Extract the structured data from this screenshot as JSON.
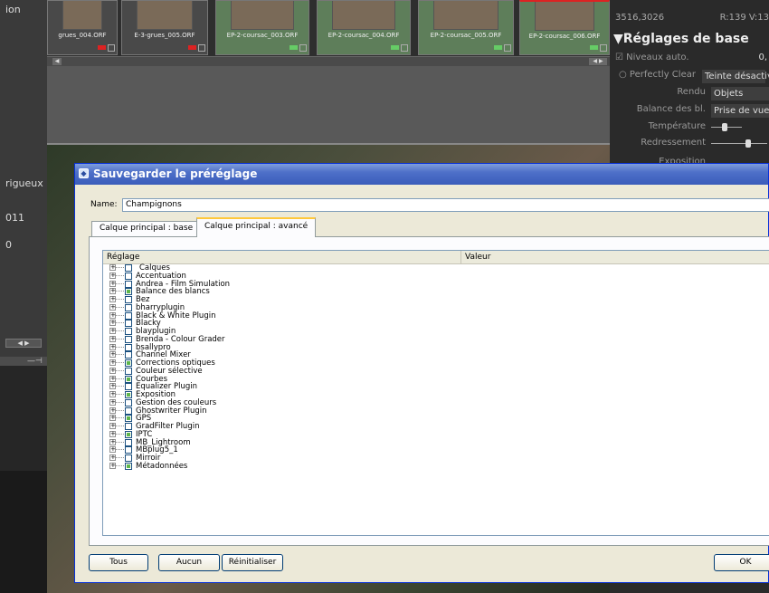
{
  "left_panel": {
    "labels": [
      "ion",
      "rigueux",
      "011",
      "0"
    ]
  },
  "filmstrip": {
    "thumbs": [
      {
        "name": "grues_004.ORF",
        "color": "gray",
        "flag": "#d22"
      },
      {
        "name": "E-3-grues_005.ORF",
        "color": "gray",
        "flag": "#d22"
      },
      {
        "name": "EP-2-coursac_003.ORF",
        "color": "green",
        "flag": "#6c6"
      },
      {
        "name": "EP-2-coursac_004.ORF",
        "color": "green",
        "flag": "#6c6"
      },
      {
        "name": "EP-2-coursac_005.ORF",
        "color": "green",
        "flag": "#6c6"
      },
      {
        "name": "EP-2-coursac_006.ORF",
        "color": "green",
        "flag": "#6c6"
      }
    ]
  },
  "right_panel": {
    "coords": "3516,3026",
    "rgb": "R:139 V:13",
    "section_title": "▼Réglages de base",
    "niveaux_label": "☑ Niveaux auto.",
    "niveaux_value": "0,",
    "perfectly_clear_label": "○ Perfectly Clear",
    "perfectly_clear_value": "Teinte désactiv",
    "rendu_label": "Rendu",
    "rendu_value": "Objets",
    "balance_label": "Balance des bl.",
    "balance_value": "Prise de vue",
    "temperature_label": "Température",
    "redressement_label": "Redressement",
    "exposition_label": "Exposition"
  },
  "dialog": {
    "title": "Sauvegarder le préréglage",
    "name_label": "Name:",
    "name_value": "Champignons",
    "tabs": [
      "Calque principal : base",
      "Calque principal : avancé"
    ],
    "col_setting": "Réglage",
    "col_value": "Valeur",
    "rows": [
      {
        "label": "Calques",
        "checked": false
      },
      {
        "label": "Accentuation",
        "checked": false
      },
      {
        "label": "Andrea - Film Simulation",
        "checked": false
      },
      {
        "label": "Balance des blancs",
        "checked": true
      },
      {
        "label": "Bez",
        "checked": false
      },
      {
        "label": "bharryplugin",
        "checked": false
      },
      {
        "label": "Black & White Plugin",
        "checked": false
      },
      {
        "label": "Blacky",
        "checked": false
      },
      {
        "label": "blayplugin",
        "checked": false
      },
      {
        "label": "Brenda - Colour Grader",
        "checked": false
      },
      {
        "label": "bsallypro",
        "checked": false
      },
      {
        "label": "Channel Mixer",
        "checked": false
      },
      {
        "label": "Corrections optiques",
        "checked": true
      },
      {
        "label": "Couleur sélective",
        "checked": false
      },
      {
        "label": "Courbes",
        "checked": true
      },
      {
        "label": "Equalizer Plugin",
        "checked": false
      },
      {
        "label": "Exposition",
        "checked": true
      },
      {
        "label": "Gestion des couleurs",
        "checked": false
      },
      {
        "label": "Ghostwriter Plugin",
        "checked": false
      },
      {
        "label": "GPS",
        "checked": true
      },
      {
        "label": "GradFilter Plugin",
        "checked": false
      },
      {
        "label": "IPTC",
        "checked": true
      },
      {
        "label": "MB_Lightroom",
        "checked": false
      },
      {
        "label": "MBplug5_1",
        "checked": false
      },
      {
        "label": "Mirroir",
        "checked": false
      },
      {
        "label": "Métadonnées",
        "checked": true
      }
    ],
    "buttons": {
      "all": "Tous",
      "none": "Aucun",
      "reset": "Réinitialiser",
      "ok": "OK"
    }
  }
}
